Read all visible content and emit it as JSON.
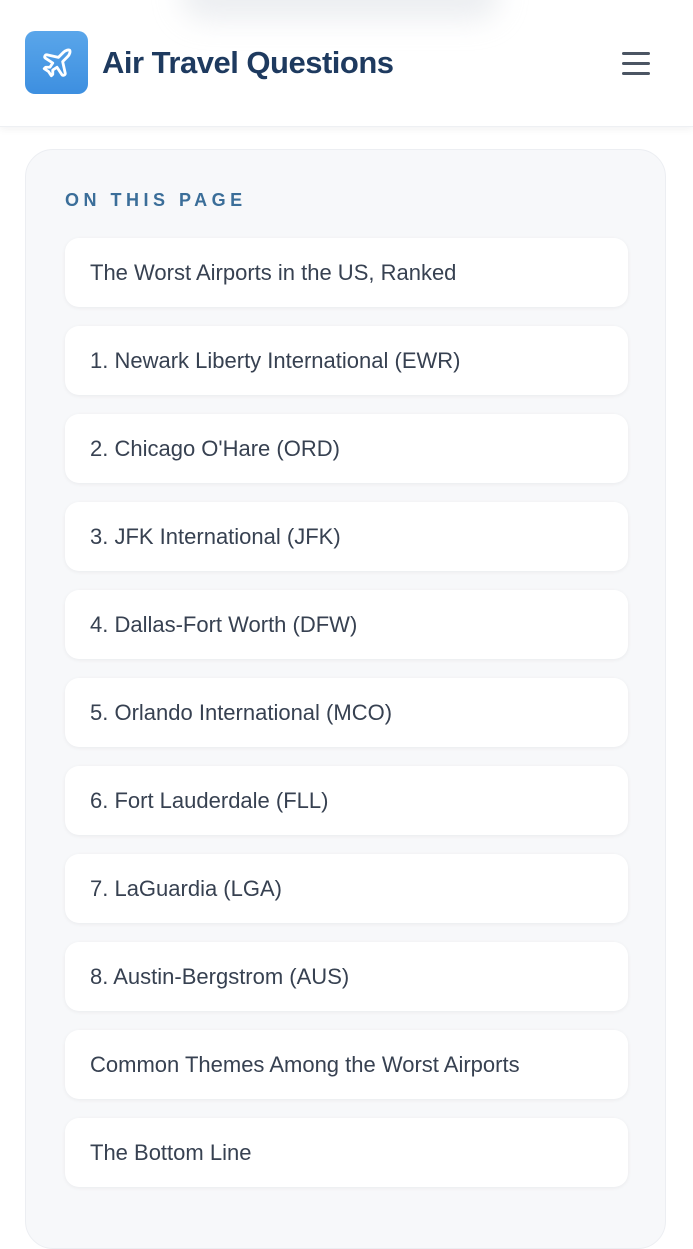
{
  "header": {
    "brand_icon": "airplane-icon",
    "brand_name": "Air Travel Questions",
    "menu_icon": "hamburger-menu-icon",
    "accent_color": "#4a9be6",
    "brand_color": "#1e3a5f"
  },
  "toc": {
    "heading": "ON THIS PAGE",
    "heading_color": "#3b6e99",
    "items": [
      {
        "label": "The Worst Airports in the US, Ranked"
      },
      {
        "label": "1. Newark Liberty International (EWR)"
      },
      {
        "label": "2. Chicago O'Hare (ORD)"
      },
      {
        "label": "3. JFK International (JFK)"
      },
      {
        "label": "4. Dallas-Fort Worth (DFW)"
      },
      {
        "label": "5. Orlando International (MCO)"
      },
      {
        "label": "6. Fort Lauderdale (FLL)"
      },
      {
        "label": "7. LaGuardia (LGA)"
      },
      {
        "label": "8. Austin-Bergstrom (AUS)"
      },
      {
        "label": "Common Themes Among the Worst Airports"
      },
      {
        "label": "The Bottom Line"
      }
    ]
  }
}
